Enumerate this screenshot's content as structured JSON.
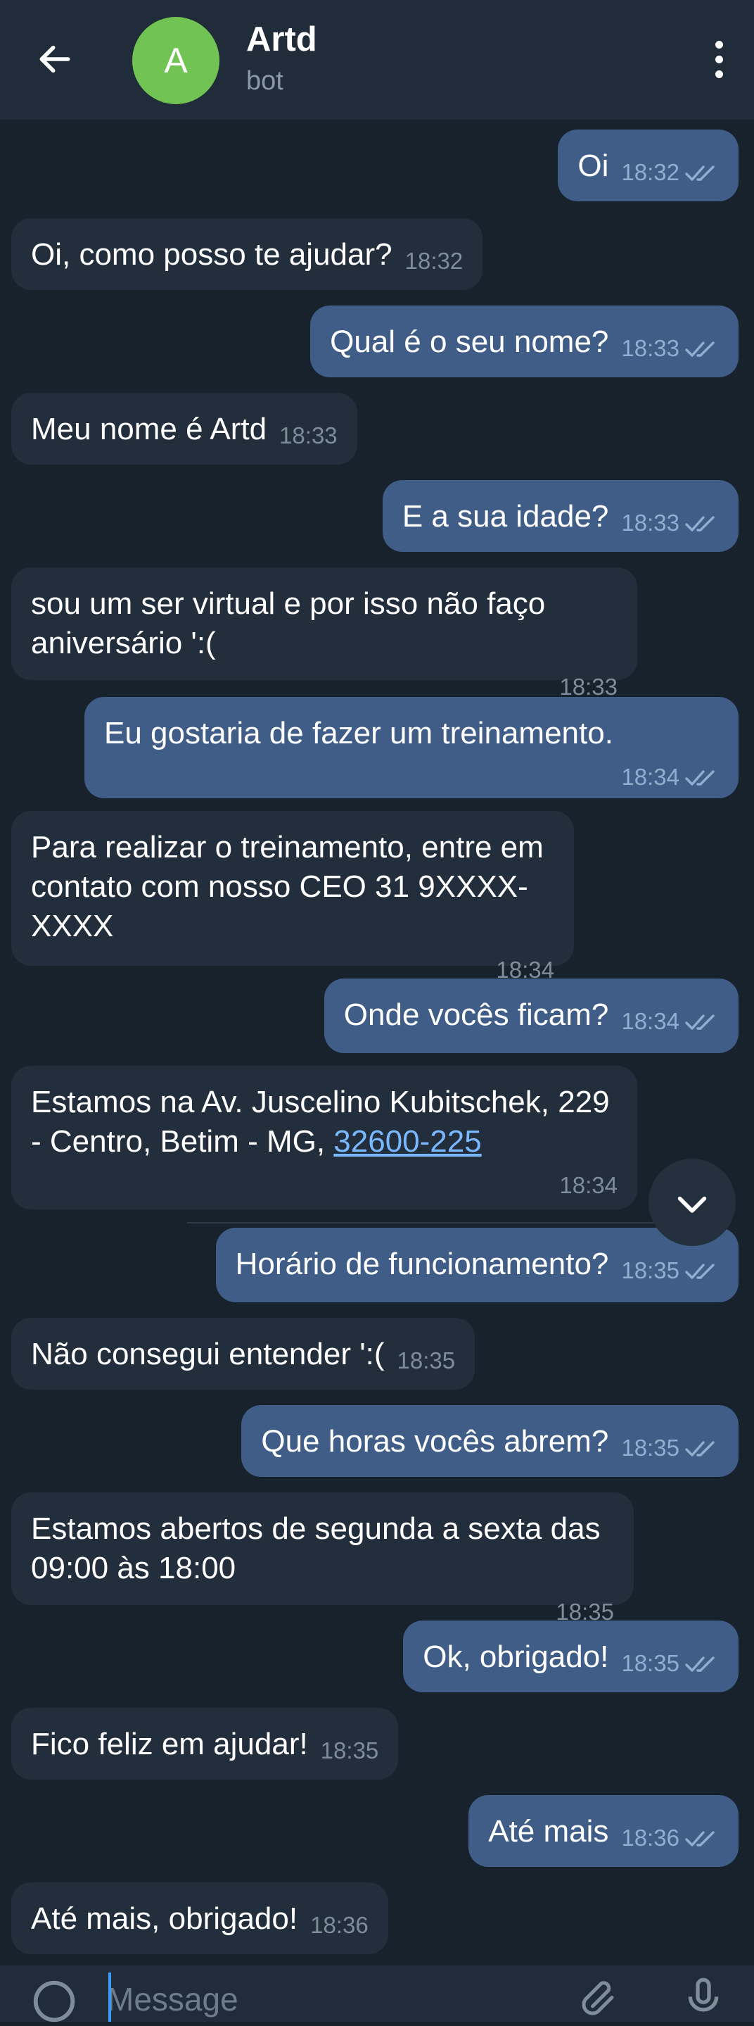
{
  "header": {
    "back_icon": "arrow-left-icon",
    "avatar_letter": "A",
    "avatar_color": "#71c453",
    "title": "Artd",
    "subtitle": "bot",
    "menu_icon": "more-vertical-icon"
  },
  "messages": [
    {
      "side": "out",
      "text": "Oi",
      "time": "18:32",
      "read": true
    },
    {
      "side": "in",
      "text": "Oi, como posso te ajudar?",
      "time": "18:32"
    },
    {
      "side": "out",
      "text": "Qual é o seu nome?",
      "time": "18:33",
      "read": true
    },
    {
      "side": "in",
      "text": "Meu nome é Artd",
      "time": "18:33"
    },
    {
      "side": "out",
      "text": "E a sua idade?",
      "time": "18:33",
      "read": true
    },
    {
      "side": "in",
      "text": "sou um ser virtual e por isso não faço aniversário ':(",
      "time": "18:33"
    },
    {
      "side": "out",
      "text": "Eu gostaria de fazer um treinamento.",
      "time": "18:34",
      "read": true
    },
    {
      "side": "in",
      "text": "Para realizar o treinamento, entre em contato com nosso CEO 31 9XXXX-XXXX",
      "time": "18:34"
    },
    {
      "side": "out",
      "text": "Onde vocês ficam?",
      "time": "18:34",
      "read": true
    },
    {
      "side": "in",
      "text": "Estamos na Av. Juscelino Kubitschek, 229 - Centro, Betim - MG, ",
      "link": "32600-225",
      "time": "18:34"
    },
    {
      "side": "out",
      "text": "Horário de funcionamento?",
      "time": "18:35",
      "read": true
    },
    {
      "side": "in",
      "text": "Não consegui entender ':(",
      "time": "18:35"
    },
    {
      "side": "out",
      "text": "Que horas vocês abrem?",
      "time": "18:35",
      "read": true
    },
    {
      "side": "in",
      "text": "Estamos abertos de segunda a sexta das 09:00 às 18:00",
      "time": "18:35"
    },
    {
      "side": "out",
      "text": "Ok, obrigado!",
      "time": "18:35",
      "read": true
    },
    {
      "side": "in",
      "text": "Fico feliz em ajudar!",
      "time": "18:35"
    },
    {
      "side": "out",
      "text": "Até mais",
      "time": "18:36",
      "read": true
    },
    {
      "side": "in",
      "text": "Até mais, obrigado!",
      "time": "18:36"
    }
  ],
  "scroll_down_icon": "chevron-down-icon",
  "composer": {
    "placeholder": "Message",
    "emoji_icon": "emoji-icon",
    "attach_icon": "paperclip-icon",
    "mic_icon": "microphone-icon"
  },
  "colors": {
    "background": "#18222d",
    "header": "#202c39",
    "incoming_bubble": "#222e3c",
    "outgoing_bubble": "#3f5d87",
    "link": "#7ab8ff",
    "checkmarks": "#91aed0"
  }
}
